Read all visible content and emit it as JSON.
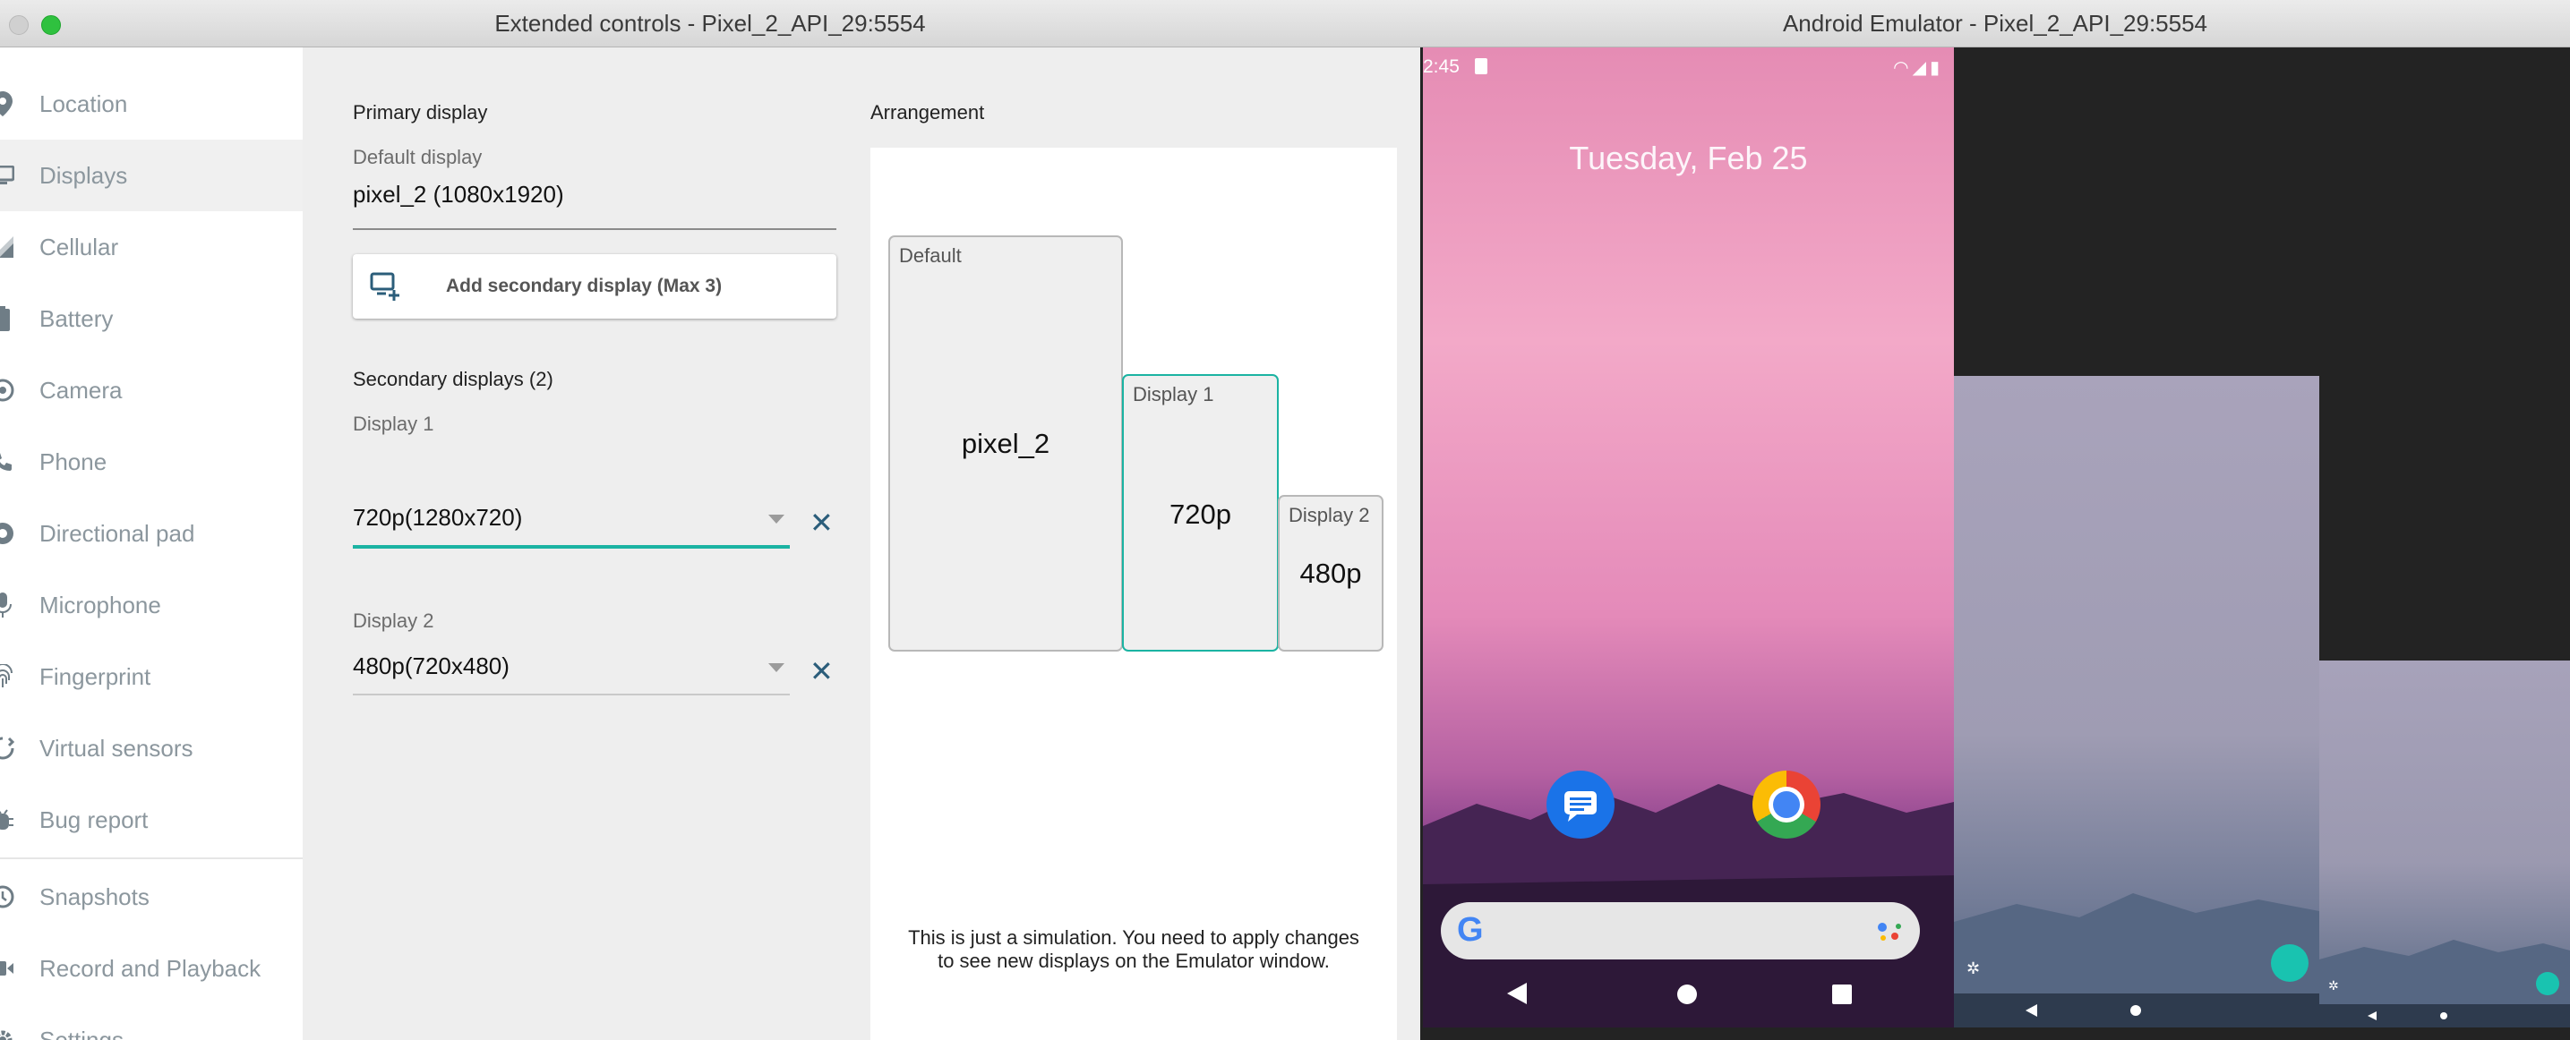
{
  "ext_window": {
    "title": "Extended controls - Pixel_2_API_29:5554",
    "sidebar": {
      "items": [
        {
          "label": "Location",
          "icon": "location-pin-icon"
        },
        {
          "label": "Displays",
          "icon": "display-icon",
          "active": true
        },
        {
          "label": "Cellular",
          "icon": "cellular-signal-icon"
        },
        {
          "label": "Battery",
          "icon": "battery-icon"
        },
        {
          "label": "Camera",
          "icon": "camera-icon"
        },
        {
          "label": "Phone",
          "icon": "phone-icon"
        },
        {
          "label": "Directional pad",
          "icon": "dpad-icon"
        },
        {
          "label": "Microphone",
          "icon": "microphone-icon"
        },
        {
          "label": "Fingerprint",
          "icon": "fingerprint-icon"
        },
        {
          "label": "Virtual sensors",
          "icon": "sensors-icon"
        },
        {
          "label": "Bug report",
          "icon": "bug-icon"
        },
        {
          "label": "Snapshots",
          "icon": "history-icon"
        },
        {
          "label": "Record and Playback",
          "icon": "record-icon"
        },
        {
          "label": "Settings",
          "icon": "gear-icon"
        }
      ]
    },
    "primary": {
      "heading": "Primary display",
      "field_label": "Default display",
      "field_value": "pixel_2 (1080x1920)"
    },
    "add_button": {
      "label": "Add secondary display (Max 3)",
      "icon": "add-display-icon"
    },
    "secondary": {
      "heading": "Secondary displays (2)",
      "displays": [
        {
          "label": "Display 1",
          "value": "720p(1280x720)",
          "focused": true
        },
        {
          "label": "Display 2",
          "value": "480p(720x480)",
          "focused": false
        }
      ]
    },
    "arrangement": {
      "heading": "Arrangement",
      "boxes": [
        {
          "name": "Default",
          "resolution": "pixel_2"
        },
        {
          "name": "Display 1",
          "resolution": "720p"
        },
        {
          "name": "Display 2",
          "resolution": "480p"
        }
      ],
      "note": "This is just a simulation. You need to apply changes to see new displays on the Emulator window."
    },
    "accent_color": "#1bb3a2"
  },
  "emulator_window": {
    "title": "Android Emulator - Pixel_2_API_29:5554",
    "status_time": "2:45",
    "date": "Tuesday, Feb 25",
    "apps": [
      {
        "icon": "messages-icon"
      },
      {
        "icon": "chrome-icon"
      }
    ],
    "search_logo": "G"
  }
}
